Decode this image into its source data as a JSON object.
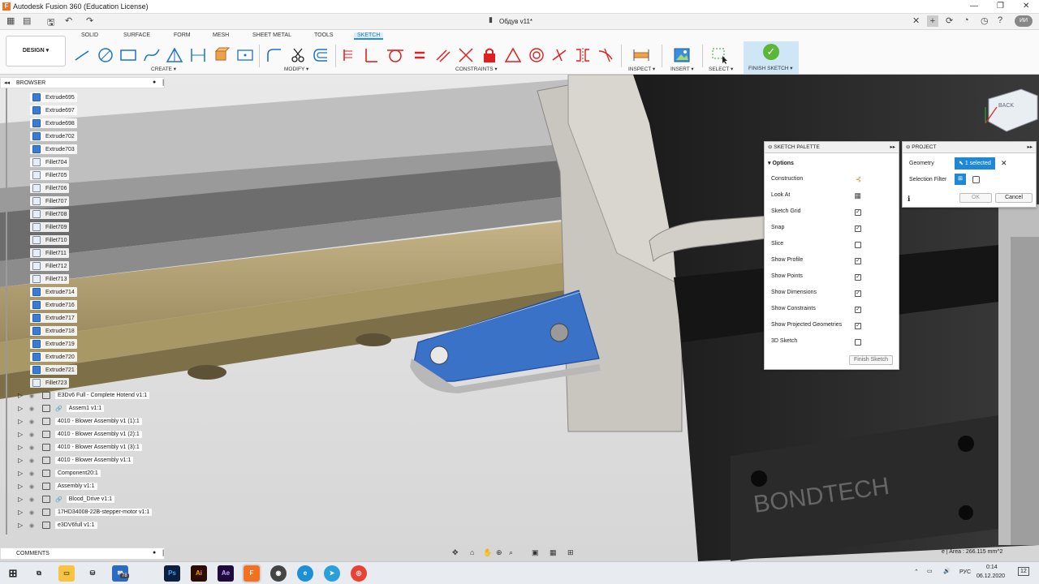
{
  "window": {
    "app_title": "Autodesk Fusion 360 (Education License)",
    "doc_title": "Обдув v11*"
  },
  "ribbon": {
    "design_label": "DESIGN",
    "tabs": [
      "SOLID",
      "SURFACE",
      "FORM",
      "MESH",
      "SHEET METAL",
      "TOOLS",
      "SKETCH"
    ],
    "active_tab": "SKETCH",
    "groups": {
      "create": "CREATE",
      "modify": "MODIFY",
      "constraints": "CONSTRAINTS",
      "inspect": "INSPECT",
      "insert": "INSERT",
      "select": "SELECT",
      "finish": "FINISH SKETCH"
    }
  },
  "browser": {
    "title": "BROWSER",
    "features": [
      {
        "label": "Extrude695",
        "icon": "extrude-icon"
      },
      {
        "label": "Extrude697",
        "icon": "extrude-icon"
      },
      {
        "label": "Extrude698",
        "icon": "extrude-icon"
      },
      {
        "label": "Extrude702",
        "icon": "extrude-icon"
      },
      {
        "label": "Extrude703",
        "icon": "extrude-icon"
      },
      {
        "label": "Fillet704",
        "icon": "fillet-icon"
      },
      {
        "label": "Fillet705",
        "icon": "fillet-icon"
      },
      {
        "label": "Fillet706",
        "icon": "fillet-icon"
      },
      {
        "label": "Fillet707",
        "icon": "fillet-icon"
      },
      {
        "label": "Fillet708",
        "icon": "fillet-icon"
      },
      {
        "label": "Fillet709",
        "icon": "fillet-icon"
      },
      {
        "label": "Fillet710",
        "icon": "fillet-icon"
      },
      {
        "label": "Fillet711",
        "icon": "fillet-icon"
      },
      {
        "label": "Fillet712",
        "icon": "fillet-icon"
      },
      {
        "label": "Fillet713",
        "icon": "fillet-icon"
      },
      {
        "label": "Extrude714",
        "icon": "extrude-icon"
      },
      {
        "label": "Extrude716",
        "icon": "extrude-icon"
      },
      {
        "label": "Extrude717",
        "icon": "extrude-icon"
      },
      {
        "label": "Extrude718",
        "icon": "extrude-icon"
      },
      {
        "label": "Extrude719",
        "icon": "extrude-icon"
      },
      {
        "label": "Extrude720",
        "icon": "extrude-icon"
      },
      {
        "label": "Extrude721",
        "icon": "extrude-icon"
      },
      {
        "label": "Fillet723",
        "icon": "fillet-icon"
      }
    ],
    "components": [
      {
        "label": "E3Dv6 Full - Complete Hotend v1:1",
        "linked": false
      },
      {
        "label": "Assem1 v1:1",
        "linked": true
      },
      {
        "label": "4010 - Blower Assembly v1 (1):1",
        "linked": false
      },
      {
        "label": "4010 - Blower Assembly v1 (2):1",
        "linked": false
      },
      {
        "label": "4010 - Blower Assembly v1 (3):1",
        "linked": false
      },
      {
        "label": "4010 - Blower Assembly v1:1",
        "linked": false
      },
      {
        "label": "Component20:1",
        "linked": false
      },
      {
        "label": "Assembly v1:1",
        "linked": false
      },
      {
        "label": "Blood_Drive v1:1",
        "linked": true
      },
      {
        "label": "17HD34008-22B-stepper-motor v1:1",
        "linked": false
      },
      {
        "label": "e3DV6full v1:1",
        "linked": false
      }
    ]
  },
  "sketch_palette": {
    "title": "SKETCH PALETTE",
    "section": "Options",
    "options": [
      {
        "label": "Construction",
        "control": "construction-icon"
      },
      {
        "label": "Look At",
        "control": "look-at-icon"
      },
      {
        "label": "Sketch Grid",
        "checked": true
      },
      {
        "label": "Snap",
        "checked": true
      },
      {
        "label": "Slice",
        "checked": false
      },
      {
        "label": "Show Profile",
        "checked": true
      },
      {
        "label": "Show Points",
        "checked": true
      },
      {
        "label": "Show Dimensions",
        "checked": true
      },
      {
        "label": "Show Constraints",
        "checked": true
      },
      {
        "label": "Show Projected Geometries",
        "checked": true
      },
      {
        "label": "3D Sketch",
        "checked": false
      }
    ],
    "finish_button": "Finish Sketch"
  },
  "project_dialog": {
    "title": "PROJECT",
    "geometry_label": "Geometry",
    "geometry_value": "1 selected",
    "filter_label": "Selection Filter",
    "ok": "OK",
    "cancel": "Cancel"
  },
  "viewcube": {
    "label": "BACK"
  },
  "comments": {
    "label": "COMMENTS"
  },
  "status": {
    "area_text": "e | Area : 266.115 mm^2"
  },
  "taskbar": {
    "mail_badge": "78",
    "app_labels": [
      "Ps",
      "Ai",
      "Ae",
      "F"
    ],
    "lang": "РУС",
    "time": "0:14",
    "date": "06.12.2020",
    "notif_count": "12"
  },
  "user": {
    "initials": "ИИ"
  },
  "colors": {
    "accent": "#2a8fd6",
    "sketch_blue": "#3a72c8",
    "finish_green": "#5ab738",
    "rail_gold": "#d8c690"
  }
}
